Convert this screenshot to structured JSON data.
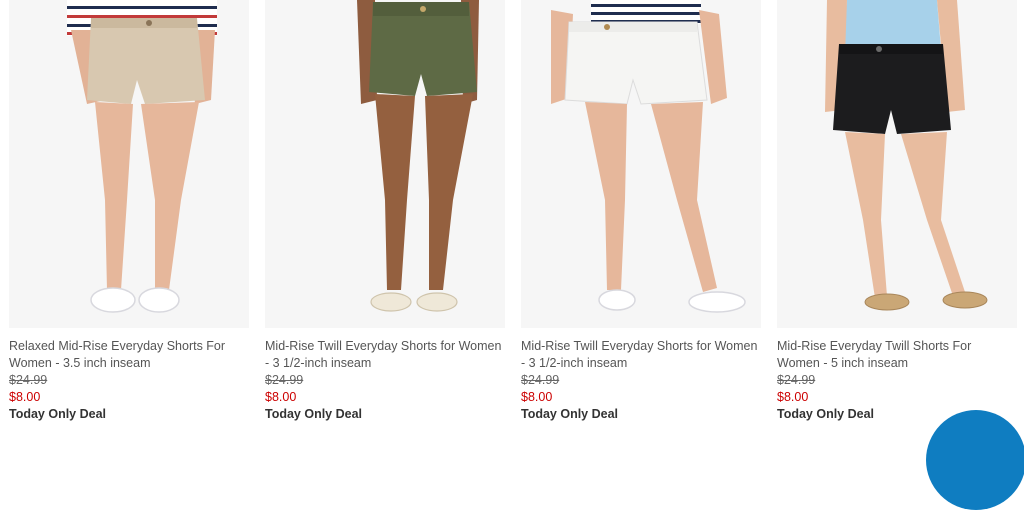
{
  "products": [
    {
      "name": "Relaxed Mid-Rise Everyday Shorts For Women - 3.5 inch inseam",
      "original_price": "$24.99",
      "sale_price": "$8.00",
      "deal": "Today Only Deal",
      "shorts_color": "#d8c8b0",
      "top": "striped-shirt",
      "shoes": "white-sneakers"
    },
    {
      "name": "Mid-Rise Twill Everyday Shorts for Women - 3 1/2-inch inseam",
      "original_price": "$24.99",
      "sale_price": "$8.00",
      "deal": "Today Only Deal",
      "shorts_color": "#5e6a45",
      "top": "none",
      "shoes": "cream-slides"
    },
    {
      "name": "Mid-Rise Twill Everyday Shorts for Women - 3 1/2-inch inseam",
      "original_price": "$24.99",
      "sale_price": "$8.00",
      "deal": "Today Only Deal",
      "shorts_color": "#f5f5f3",
      "top": "striped-shirt",
      "shoes": "white-slip-ons"
    },
    {
      "name": "Mid-Rise Everyday Twill Shorts For Women - 5 inch inseam",
      "original_price": "$24.99",
      "sale_price": "$8.00",
      "deal": "Today Only Deal",
      "shorts_color": "#1c1c1e",
      "top": "light-blue-blouse",
      "shoes": "tan-flats"
    }
  ],
  "colors": {
    "sale_red": "#cc0000",
    "chat_blue": "#0f7dc1",
    "skin": "#d9a789",
    "skin_dark": "#9b6a4c"
  }
}
